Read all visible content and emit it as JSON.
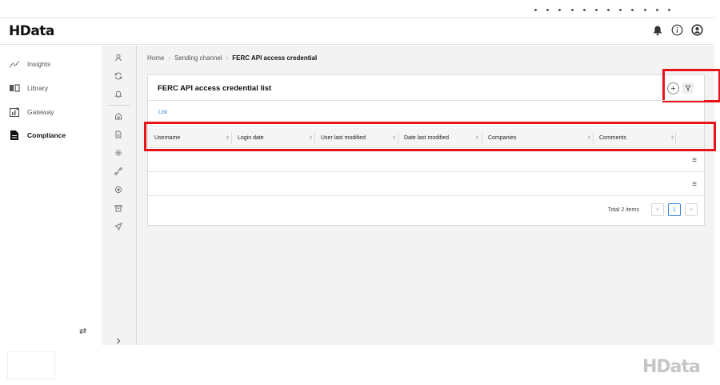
{
  "brand": "HData",
  "sidebar": {
    "items": [
      {
        "label": "Insights",
        "icon": "insights-icon"
      },
      {
        "label": "Library",
        "icon": "library-icon"
      },
      {
        "label": "Gateway",
        "icon": "gateway-icon"
      },
      {
        "label": "Compliance",
        "icon": "document-icon",
        "active": true
      }
    ]
  },
  "breadcrumb": [
    "Home",
    "Sending channel",
    "FERC API access credential"
  ],
  "card": {
    "title": "FERC API access credential list",
    "tab": "List",
    "columns": [
      "Username",
      "Login date",
      "User last modified",
      "Date last modified",
      "Companies",
      "Comments"
    ]
  },
  "pagination": {
    "total": "Total 2 items",
    "current_page": "1",
    "prev": "<",
    "next": ">"
  },
  "colors": {
    "accent": "#2f7fd8",
    "highlight": "#e8141a"
  }
}
